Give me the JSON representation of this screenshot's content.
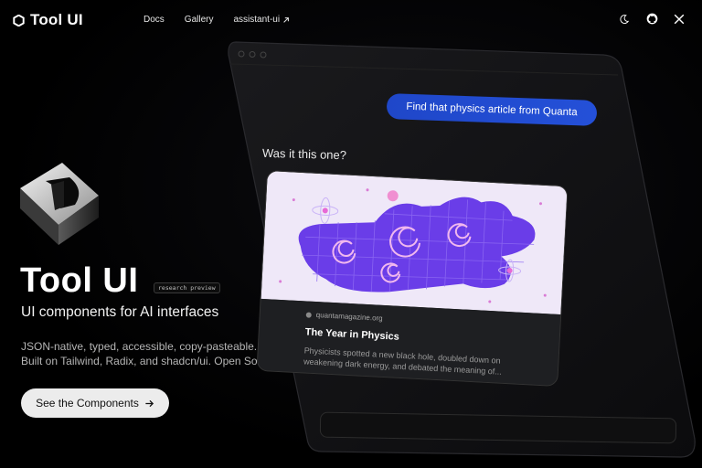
{
  "nav": {
    "brand": "Tool UI",
    "links": [
      {
        "label": "Docs"
      },
      {
        "label": "Gallery"
      },
      {
        "label": "assistant-ui",
        "external_icon": "arrow-up-right-icon"
      }
    ],
    "icons": [
      "moon-icon",
      "github-icon",
      "x-icon"
    ]
  },
  "hero": {
    "title": "Tool UI",
    "badge": "research preview",
    "subtitle": "UI components for AI interfaces",
    "description_line1": "JSON-native, typed, accessible, copy-pasteable.",
    "description_line2": "Built on Tailwind, Radix, and shadcn/ui. Open Source.",
    "cta_label": "See the Components"
  },
  "chat": {
    "user_message": "Find that physics article from Quanta",
    "assistant_message": "Was it this one?",
    "card": {
      "source": "quantamagazine.org",
      "title": "The Year in Physics",
      "description": "Physicists spotted a new black hole, doubled down on weakening dark energy, and debated the meaning of..."
    }
  },
  "colors": {
    "background": "#000000",
    "bubble": "#2450d8",
    "card_art": "#6a3de8",
    "cta_bg": "#ececec"
  }
}
